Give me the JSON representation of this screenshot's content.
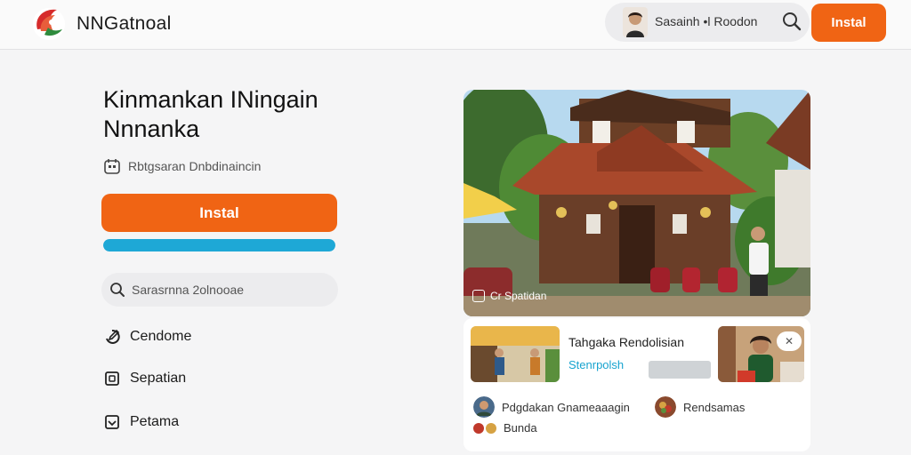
{
  "header": {
    "brand": "NNGatnoal",
    "user_name": "Sasainh •l Roodon",
    "install_label": "Instal"
  },
  "hero": {
    "title": "Kinmankan INingain Nnnanka",
    "meta_text": "Rbtgsaran Dnbdinaincin",
    "install_label": "Instal",
    "progress_fraction": 1.0
  },
  "search": {
    "placeholder": "Sarasrnna 2olnooae"
  },
  "menu": {
    "items": [
      {
        "label": "Cendome",
        "icon": "edit-icon"
      },
      {
        "label": "Sepatian",
        "icon": "square-icon"
      },
      {
        "label": "Petama",
        "icon": "inbox-icon"
      }
    ]
  },
  "photo": {
    "caption": "Cr Spatidan"
  },
  "card": {
    "title": "Tahgaka Rendolisian",
    "link": "Stenrpolsh",
    "close_label": "✕",
    "chips": [
      {
        "label": "Pdgdakan Gnameaaagin"
      },
      {
        "label": "Rendsamas"
      },
      {
        "label": "Bunda"
      }
    ]
  },
  "colors": {
    "accent": "#f06414",
    "progress": "#1ea8d6",
    "link": "#17a3cf"
  }
}
